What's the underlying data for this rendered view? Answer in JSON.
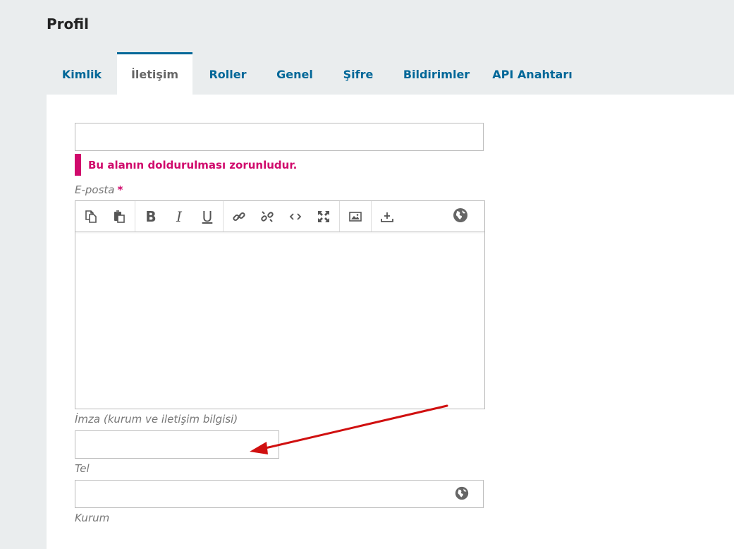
{
  "page": {
    "title": "Profil"
  },
  "tabs": [
    {
      "label": "Kimlik",
      "active": false
    },
    {
      "label": "İletişim",
      "active": true
    },
    {
      "label": "Roller",
      "active": false
    },
    {
      "label": "Genel",
      "active": false
    },
    {
      "label": "Şifre",
      "active": false
    },
    {
      "label": "Bildirimler",
      "active": false
    },
    {
      "label": "API Anahtarı",
      "active": false
    }
  ],
  "form": {
    "email_value": "",
    "error_message": "Bu alanın doldurulması zorunludur.",
    "email_label": "E-posta",
    "required_marker": "*",
    "signature_label": "İmza (kurum ve iletişim bilgisi)",
    "phone_value": "",
    "phone_label": "Tel",
    "institution_value": "",
    "institution_label": "Kurum"
  },
  "toolbar_icons": [
    "copy-icon",
    "paste-icon",
    "bold-icon",
    "italic-icon",
    "underline-icon",
    "link-icon",
    "unlink-icon",
    "code-icon",
    "fullscreen-icon",
    "image-icon",
    "upload-icon",
    "globe-icon"
  ],
  "colors": {
    "accent": "#006798",
    "error": "#d00a6c",
    "annotation_arrow": "#d01010"
  }
}
